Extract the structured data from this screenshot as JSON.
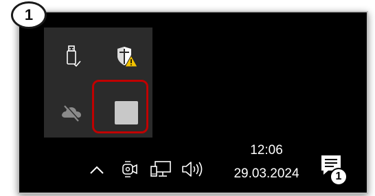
{
  "step_badge": "1",
  "clock": {
    "time": "12:06",
    "date": "29.03.2024"
  },
  "notification": {
    "count": "1"
  },
  "colors": {
    "taskbar_bg": "#000000",
    "flyout_bg": "#2b2b2b",
    "highlight": "#c00000",
    "warning": "#f2c200"
  },
  "flyout_icons": [
    "usb-safely-remove-icon",
    "windows-security-warning-icon",
    "onedrive-offline-icon",
    "app-tray-icon"
  ],
  "tray_icons": [
    "chevron-up-icon",
    "camera-icon",
    "network-icon",
    "volume-icon",
    "notification-icon"
  ]
}
